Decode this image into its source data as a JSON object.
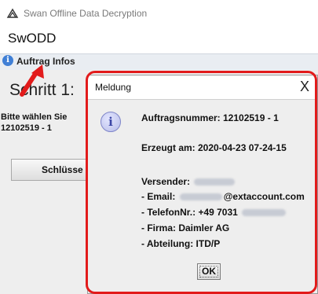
{
  "window": {
    "title": "Swan Offline Data Decryption",
    "app_name": "SwODD"
  },
  "info_bar": {
    "icon": "info-icon",
    "label": "Auftrag Infos"
  },
  "main": {
    "step_title": "Schritt 1:",
    "hint_line1": "Bitte wählen Sie",
    "hint_line2": "12102519 - 1",
    "key_button_label": "Schlüsse"
  },
  "dialog": {
    "title": "Meldung",
    "close_symbol": "X",
    "icon": "info-icon",
    "order_number": "Auftragsnummer: 12102519 - 1",
    "created_at": "Erzeugt am: 2020-04-23 07-24-15",
    "sender_label": "Versender:",
    "email_prefix": "- Email:",
    "email_domain": "@extaccount.com",
    "phone_prefix": "- TelefonNr.: +49 7031",
    "company": "- Firma: Daimler AG",
    "department": "- Abteilung: ITD/P",
    "ok_label": "OK"
  },
  "annotations": {
    "highlight_color": "#e21b1b",
    "arrow_color": "#e21b1b"
  }
}
